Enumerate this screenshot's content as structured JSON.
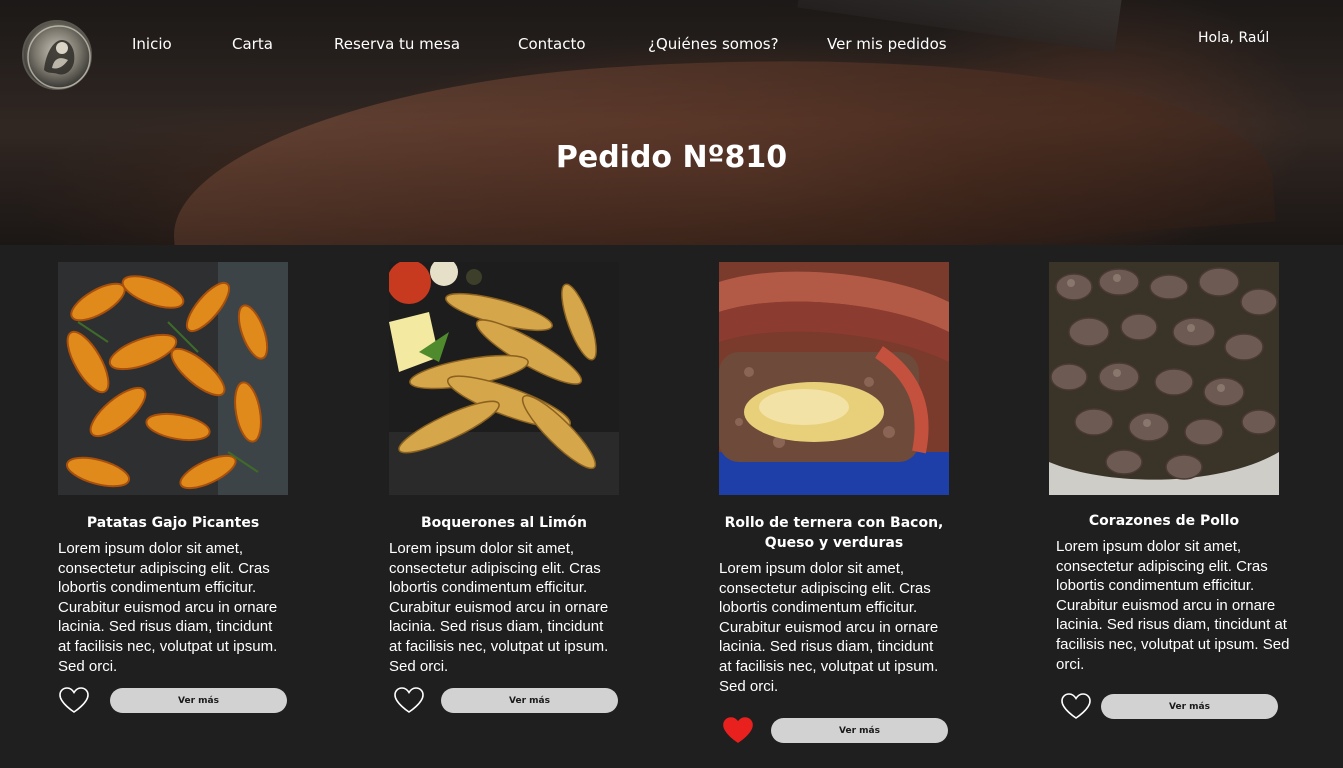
{
  "nav": {
    "logo_icon": "restaurant-logo-icon",
    "items": [
      {
        "label": "Inicio"
      },
      {
        "label": "Carta"
      },
      {
        "label": "Reserva tu mesa"
      },
      {
        "label": "Contacto"
      },
      {
        "label": "¿Quiénes somos?"
      },
      {
        "label": "Ver mis pedidos"
      }
    ],
    "greeting": "Hola, Raúl"
  },
  "hero": {
    "title": "Pedido Nº810"
  },
  "products": [
    {
      "title": "Patatas Gajo Picantes",
      "description": "Lorem ipsum dolor sit amet, consectetur adipiscing elit. Cras lobortis condimentum efficitur. Curabitur euismod arcu in ornare lacinia. Sed risus diam, tincidunt at facilisis nec, volutpat ut ipsum. Sed orci.",
      "button": "Ver más",
      "favorite": false,
      "image": "potato-wedges-photo"
    },
    {
      "title": "Boquerones al Limón",
      "description": "Lorem ipsum dolor sit amet, consectetur adipiscing elit. Cras lobortis condimentum efficitur. Curabitur euismod arcu in ornare lacinia. Sed risus diam, tincidunt at facilisis nec, volutpat ut ipsum. Sed orci.",
      "button": "Ver más",
      "favorite": false,
      "image": "fried-anchovies-photo"
    },
    {
      "title": "Rollo de ternera con Bacon, Queso y verduras",
      "description": "Lorem ipsum dolor sit amet, consectetur adipiscing elit. Cras lobortis condimentum efficitur. Curabitur euismod arcu in ornare lacinia. Sed risus diam, tincidunt at facilisis nec, volutpat ut ipsum. Sed orci.",
      "button": "Ver más",
      "favorite": true,
      "image": "beef-roll-photo"
    },
    {
      "title": "Corazones de Pollo",
      "description": "Lorem ipsum dolor sit amet, consectetur adipiscing elit. Cras lobortis condimentum efficitur. Curabitur euismod arcu in ornare lacinia. Sed risus diam, tincidunt at facilisis nec, volutpat ut ipsum. Sed orci.",
      "button": "Ver más",
      "favorite": false,
      "image": "chicken-hearts-photo"
    }
  ],
  "colors": {
    "background": "#1f1f1f",
    "button": "#d2d2d2",
    "heart_active": "#e8201e",
    "heart_outline": "#ffffff"
  }
}
